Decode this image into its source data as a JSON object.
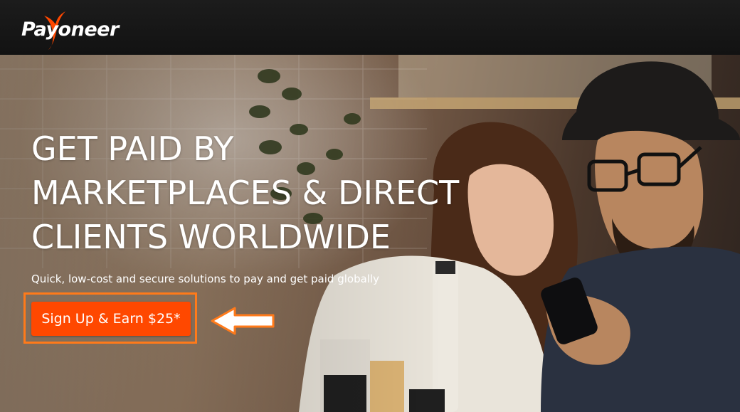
{
  "header": {
    "logo_text": "Payoneer",
    "logo_icon": "payoneer-swoosh",
    "background": "#161616"
  },
  "hero": {
    "headline_lines": [
      "GET PAID BY",
      "MARKETPLACES & DIRECT",
      "CLIENTS WORLDWIDE"
    ],
    "subheadline": "Quick, low-cost and secure solutions to pay and get paid globally",
    "cta_label": "Sign Up & Earn $25*",
    "cta_color": "#ff4800",
    "highlight_color": "#ff7a1a",
    "pointer_icon": "left-arrow-icon",
    "photo": "two people looking at a phone in a cafe"
  }
}
